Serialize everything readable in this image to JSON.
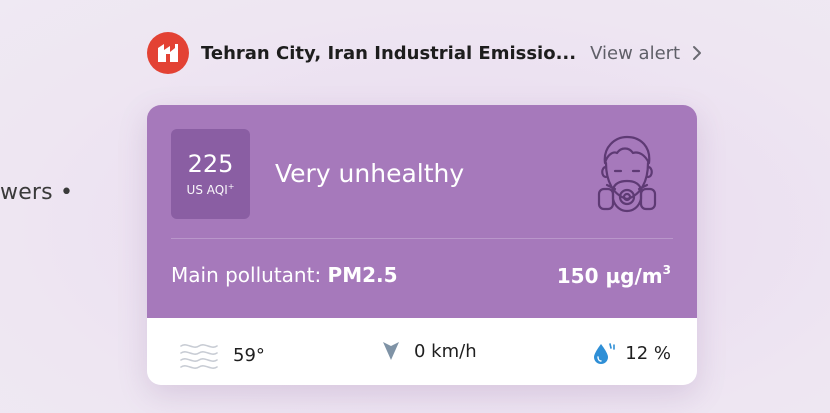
{
  "left_snippet": "wers •",
  "alert": {
    "title": "Tehran City, Iran Industrial Emissio...",
    "view_label": "View alert",
    "logo_color": "#e34234"
  },
  "aqi": {
    "value": "225",
    "unit": "US AQI",
    "unit_superscript": "+",
    "level": "Very unhealthy",
    "level_color": "#a679bb",
    "icon": "gas-mask-icon"
  },
  "pollutant": {
    "label": "Main pollutant:",
    "name": "PM2.5",
    "value": "150 µg/m",
    "value_superscript": "3"
  },
  "weather": {
    "temperature": "59°",
    "temperature_icon": "wind-waves-icon",
    "wind": "0 km/h",
    "wind_icon": "wind-direction-arrow-icon",
    "humidity": "12 %",
    "humidity_icon": "water-drop-icon"
  }
}
